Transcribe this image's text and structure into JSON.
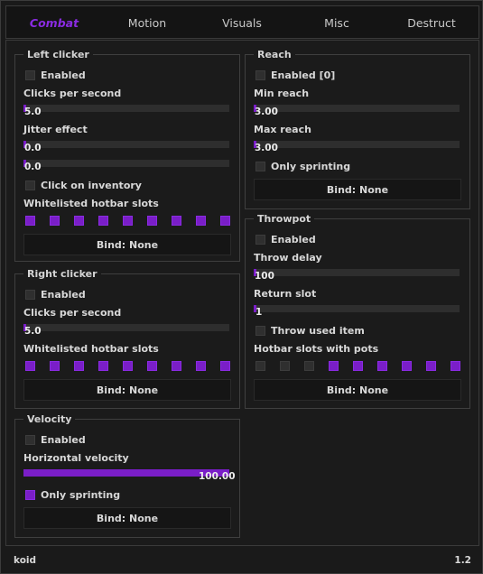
{
  "colors": {
    "accent": "#8a2be2",
    "background": "#1b1b1b",
    "track": "#2e2e2e"
  },
  "tabs": [
    {
      "label": "Combat",
      "active": true
    },
    {
      "label": "Motion",
      "active": false
    },
    {
      "label": "Visuals",
      "active": false
    },
    {
      "label": "Misc",
      "active": false
    },
    {
      "label": "Destruct",
      "active": false
    }
  ],
  "left_clicker": {
    "title": "Left clicker",
    "enabled_label": "Enabled",
    "enabled": false,
    "cps_label": "Clicks per second",
    "cps_value": "5.0",
    "cps_fill": 0.015,
    "jitter_label": "Jitter effect",
    "jitter_value_1": "0.0",
    "jitter_fill_1": 0.015,
    "jitter_value_2": "0.0",
    "jitter_fill_2": 0.015,
    "inventory_label": "Click on inventory",
    "inventory": false,
    "slots_label": "Whitelisted hotbar slots",
    "slots": [
      true,
      true,
      true,
      true,
      true,
      true,
      true,
      true,
      true
    ],
    "bind_label": "Bind: None"
  },
  "right_clicker": {
    "title": "Right clicker",
    "enabled_label": "Enabled",
    "enabled": false,
    "cps_label": "Clicks per second",
    "cps_value": "5.0",
    "cps_fill": 0.015,
    "slots_label": "Whitelisted hotbar slots",
    "slots": [
      true,
      true,
      true,
      true,
      true,
      true,
      true,
      true,
      true
    ],
    "bind_label": "Bind: None"
  },
  "velocity": {
    "title": "Velocity",
    "enabled_label": "Enabled",
    "enabled": false,
    "horizontal_label": "Horizontal velocity",
    "horizontal_value": "100.00",
    "horizontal_fill": 1.0,
    "sprint_label": "Only sprinting",
    "sprint": true,
    "bind_label": "Bind: None"
  },
  "reach": {
    "title": "Reach",
    "enabled_label": "Enabled [0]",
    "enabled": false,
    "min_label": "Min reach",
    "min_value": "3.00",
    "min_fill": 0.015,
    "max_label": "Max reach",
    "max_value": "3.00",
    "max_fill": 0.015,
    "sprint_label": "Only sprinting",
    "sprint": false,
    "bind_label": "Bind: None"
  },
  "throwpot": {
    "title": "Throwpot",
    "enabled_label": "Enabled",
    "enabled": false,
    "delay_label": "Throw delay",
    "delay_value": "100",
    "delay_fill": 0.015,
    "return_label": "Return slot",
    "return_value": "1",
    "return_fill": 0.015,
    "throw_used_label": "Throw used item",
    "throw_used": false,
    "slots_label": "Hotbar slots with pots",
    "slots": [
      false,
      false,
      false,
      true,
      true,
      true,
      true,
      true,
      true
    ],
    "bind_label": "Bind: None"
  },
  "footer": {
    "left": "koid",
    "right": "1.2"
  }
}
